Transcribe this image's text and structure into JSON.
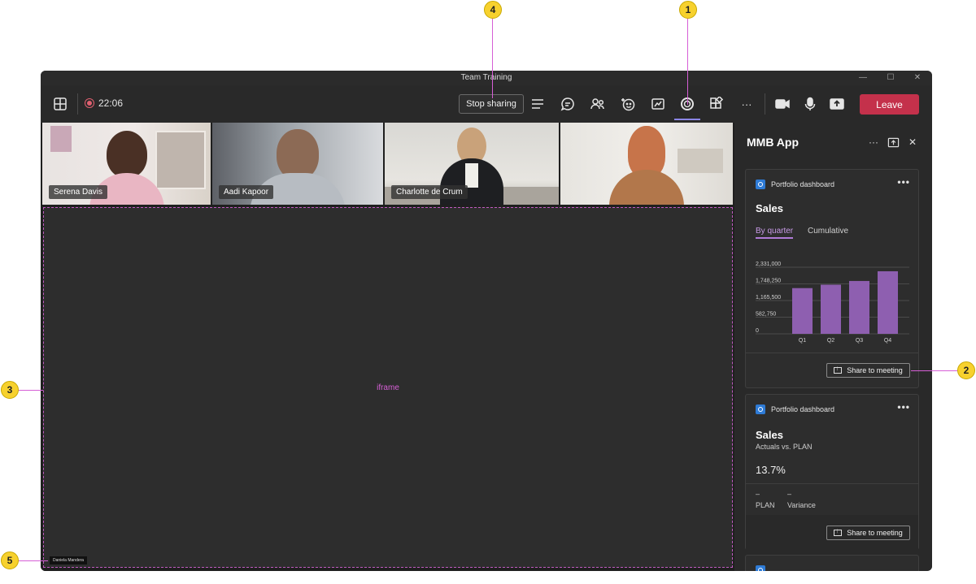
{
  "callouts": [
    "1",
    "2",
    "3",
    "4",
    "5"
  ],
  "window": {
    "title": "Team Training",
    "controls": [
      "—",
      "☐",
      "✕"
    ]
  },
  "toolbar": {
    "timer": "22:06",
    "stop_sharing_label": "Stop sharing",
    "leave_label": "Leave",
    "more_glyph": "···",
    "icons": [
      "grid-icon",
      "notes-icon",
      "chat-icon",
      "people-icon",
      "reactions-icon",
      "whiteboard-icon",
      "mmb-app-icon",
      "apps-icon",
      "more-icon",
      "camera-icon",
      "mic-icon",
      "share-icon"
    ]
  },
  "participants": [
    {
      "name": "Serena Davis"
    },
    {
      "name": "Aadi Kapoor"
    },
    {
      "name": "Charlotte de Crum"
    },
    {
      "name": ""
    }
  ],
  "stage": {
    "iframe_label": "iframe",
    "presenter_name": "Daniela Mandera"
  },
  "panel": {
    "title": "MMB App",
    "more_glyph": "···",
    "close_glyph": "✕"
  },
  "card1": {
    "app_name": "Portfolio dashboard",
    "more_glyph": "•••",
    "title": "Sales",
    "tab_active": "By quarter",
    "tab_inactive": "Cumulative",
    "share_label": "Share to meeting"
  },
  "card2": {
    "app_name": "Portfolio dashboard",
    "more_glyph": "•••",
    "title": "Sales",
    "subtitle": "Actuals vs. PLAN",
    "percent": "13.7%",
    "plan_value": "–",
    "plan_label": "PLAN",
    "variance_value": "–",
    "variance_label": "Variance",
    "share_label": "Share to meeting"
  },
  "colors": {
    "bar": "#8e5fb0",
    "accent": "#b07bd8",
    "leave": "#c4314b"
  },
  "chart_data": {
    "type": "bar",
    "categories": [
      "Q1",
      "Q2",
      "Q3",
      "Q4"
    ],
    "values": [
      1600000,
      1720000,
      1850000,
      2190000
    ],
    "ytick_labels": [
      "0",
      "582,750",
      "1,165,500",
      "1,748,250",
      "2,331,000"
    ],
    "yticks": [
      0,
      582750,
      1165500,
      1748250,
      2331000
    ],
    "ylim": [
      0,
      2331000
    ],
    "grid": true
  }
}
